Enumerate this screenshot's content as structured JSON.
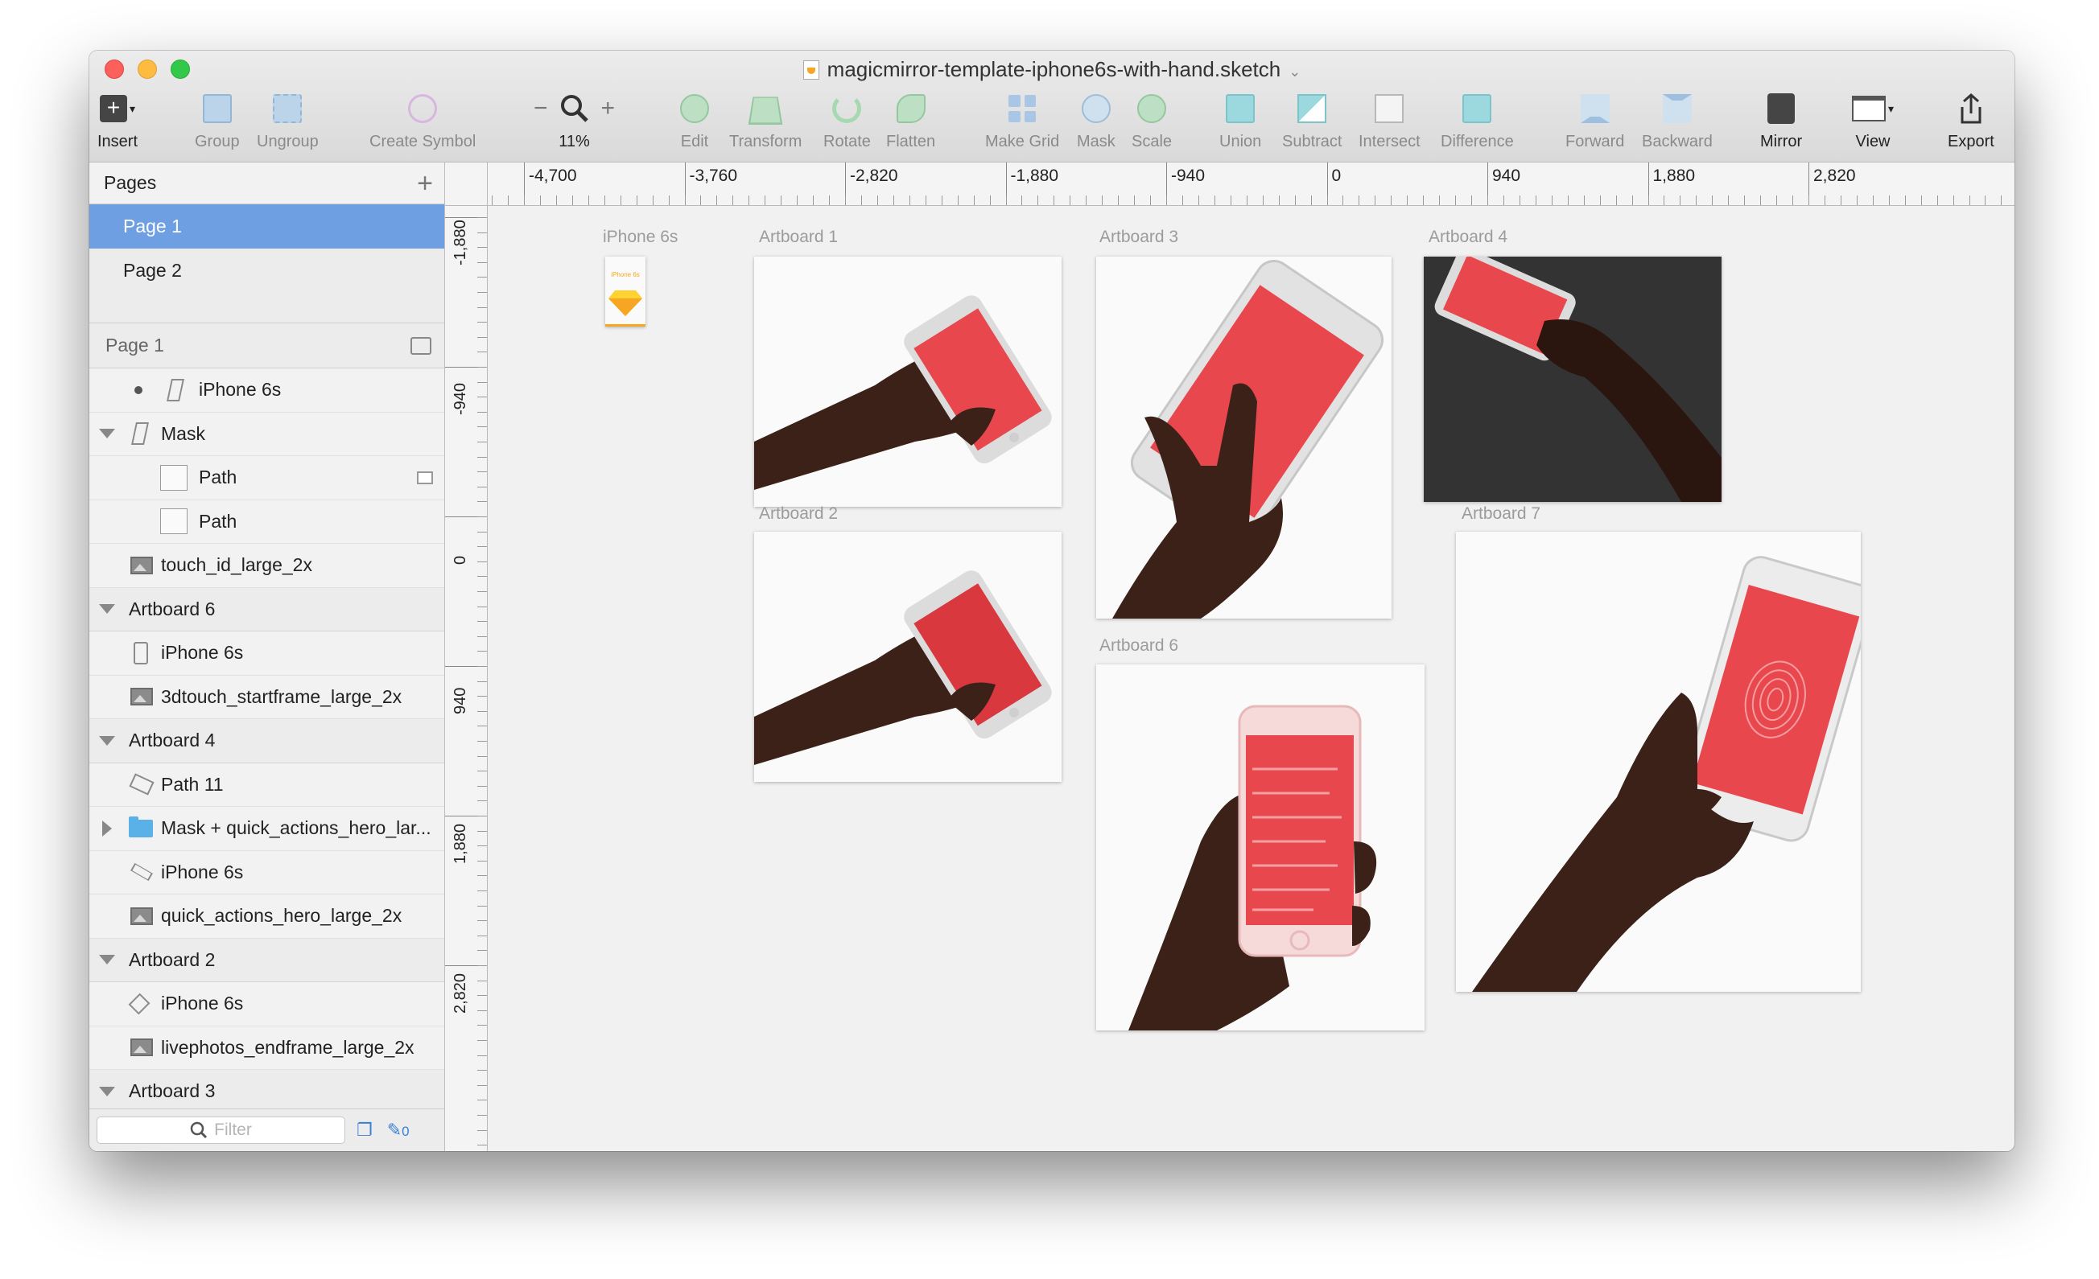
{
  "window": {
    "title": "magicmirror-template-iphone6s-with-hand.sketch"
  },
  "toolbar": {
    "insert": "Insert",
    "group": "Group",
    "ungroup": "Ungroup",
    "create_symbol": "Create Symbol",
    "zoom_minus": "−",
    "zoom_plus": "+",
    "zoom_level": "11%",
    "edit": "Edit",
    "transform": "Transform",
    "rotate": "Rotate",
    "flatten": "Flatten",
    "make_grid": "Make Grid",
    "mask": "Mask",
    "scale": "Scale",
    "union": "Union",
    "subtract": "Subtract",
    "intersect": "Intersect",
    "difference": "Difference",
    "forward": "Forward",
    "backward": "Backward",
    "mirror": "Mirror",
    "view": "View",
    "export": "Export"
  },
  "pages": {
    "header": "Pages",
    "add": "+",
    "items": [
      {
        "label": "Page 1",
        "selected": true
      },
      {
        "label": "Page 2",
        "selected": false
      }
    ]
  },
  "layers": {
    "header": "Page 1",
    "items": [
      {
        "label": "iPhone 6s"
      },
      {
        "label": "Mask"
      },
      {
        "label": "Path"
      },
      {
        "label": "Path"
      },
      {
        "label": "touch_id_large_2x"
      },
      {
        "label": "Artboard 6"
      },
      {
        "label": "iPhone 6s"
      },
      {
        "label": "3dtouch_startframe_large_2x"
      },
      {
        "label": "Artboard 4"
      },
      {
        "label": "Path 11"
      },
      {
        "label": "Mask + quick_actions_hero_lar..."
      },
      {
        "label": "iPhone 6s"
      },
      {
        "label": "quick_actions_hero_large_2x"
      },
      {
        "label": "Artboard 2"
      },
      {
        "label": "iPhone 6s"
      },
      {
        "label": "livephotos_endframe_large_2x"
      },
      {
        "label": "Artboard 3"
      }
    ],
    "filter_placeholder": "Filter",
    "edited_count": "0"
  },
  "rulers": {
    "horizontal": [
      "-4,700",
      "-3,760",
      "-2,820",
      "-1,880",
      "-940",
      "0",
      "940",
      "1,880",
      "2,820"
    ],
    "vertical": [
      "-1,880",
      "-940",
      "0",
      "940",
      "1,880",
      "2,820"
    ]
  },
  "artboards": [
    {
      "label": "iPhone 6s"
    },
    {
      "label": "Artboard 1"
    },
    {
      "label": "Artboard 2"
    },
    {
      "label": "Artboard 3"
    },
    {
      "label": "Artboard 4"
    },
    {
      "label": "Artboard 6"
    },
    {
      "label": "Artboard 7"
    }
  ],
  "mini_artboard_text": "iPhone 6s",
  "colors": {
    "selection": "#6f9fe3",
    "screen_red": "#e8474d",
    "skin": "#3b2118"
  }
}
